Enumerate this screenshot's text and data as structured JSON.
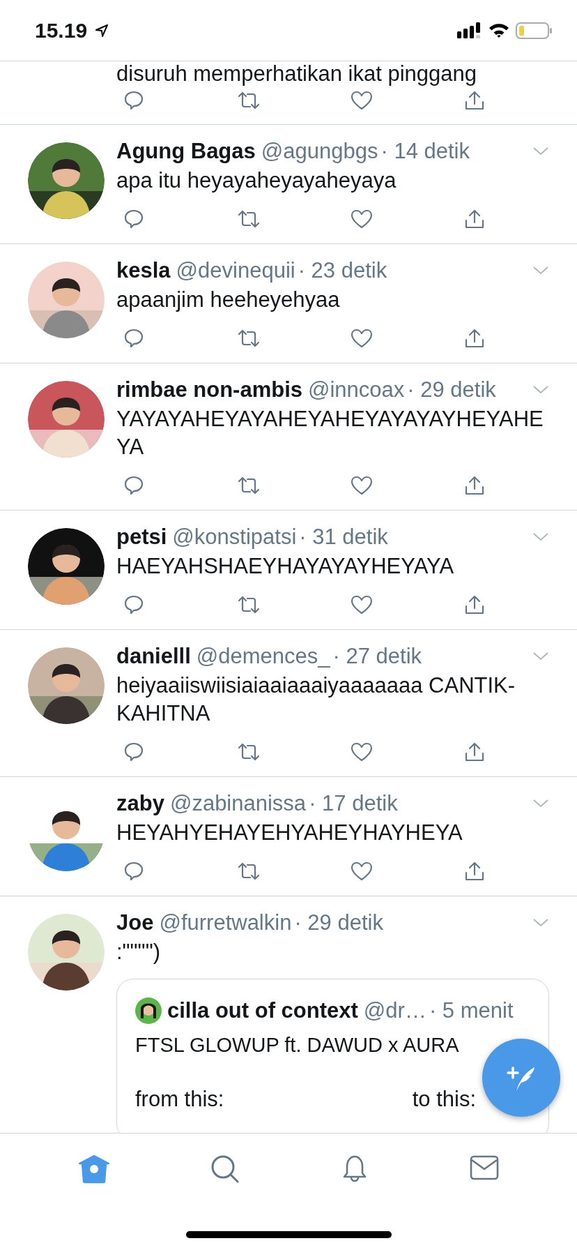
{
  "status_bar": {
    "time": "15.19"
  },
  "tweets": [
    {
      "kind": "partial",
      "text": "disuruh memperhatikan ikat pinggang"
    },
    {
      "kind": "tweet",
      "name": "Agung Bagas",
      "handle": "@agungbgs",
      "time": "· 14 detik",
      "text": "apa itu heyayaheyayaheyaya"
    },
    {
      "kind": "tweet",
      "name": "kesla",
      "handle": "@devinequii",
      "time": "· 23 detik",
      "text": "apaanjim heeheyehyaa"
    },
    {
      "kind": "tweet",
      "name": "rimbae non-ambis",
      "handle": "@inncoax",
      "time": "· 29 detik",
      "text": "YAYAYAHEYAYAHEYAHEYAYAYAYHEYAHEYA"
    },
    {
      "kind": "tweet",
      "name": "petsi",
      "handle": "@konstipatsi",
      "time": "· 31 detik",
      "text": "HAEYAHSHAEYHAYAYAYHEYAYA"
    },
    {
      "kind": "tweet",
      "name": "danielll",
      "handle": "@demences_",
      "time": "· 27 detik",
      "text": "heiyaaiiswiisiaiaaiaaaiyaaaaaaa CANTIK-KAHITNA"
    },
    {
      "kind": "tweet",
      "name": "zaby",
      "handle": "@zabinanissa",
      "time": "· 17 detik",
      "text": "HEYAHYEHAYEHYAHEYHAYHEYA"
    },
    {
      "kind": "quote",
      "name": "Joe",
      "handle": "@furretwalkin",
      "time": "· 29 detik",
      "text": ":\"\"\"\")",
      "quote": {
        "name": "cilla out of context",
        "handle": "@dr…",
        "time": "· 5 menit",
        "text": "FTSL GLOWUP ft. DAWUD x AURA",
        "captions": [
          "from this:",
          "to this:"
        ]
      }
    }
  ],
  "nav": [
    {
      "kind": "home",
      "selected": true
    },
    {
      "kind": "search",
      "selected": false
    },
    {
      "kind": "bell",
      "selected": false
    },
    {
      "kind": "mail",
      "selected": false
    }
  ]
}
